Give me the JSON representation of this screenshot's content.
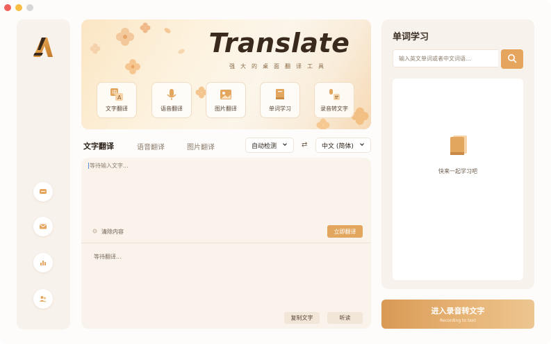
{
  "window": {
    "controls": [
      "close",
      "minimize",
      "maximize"
    ]
  },
  "sidebar": {
    "logo_letter": "A",
    "items": [
      {
        "icon": "chat-bubble-icon"
      },
      {
        "icon": "mail-icon"
      },
      {
        "icon": "chart-icon"
      },
      {
        "icon": "users-icon"
      }
    ]
  },
  "banner": {
    "title": "Translate",
    "subtitle": "强大的桌面翻译工具",
    "features": [
      {
        "label": "文字翻译",
        "icon": "text-translate-icon"
      },
      {
        "label": "语音翻译",
        "icon": "microphone-icon"
      },
      {
        "label": "图片翻译",
        "icon": "image-icon"
      },
      {
        "label": "单词学习",
        "icon": "book-icon"
      },
      {
        "label": "录音转文字",
        "icon": "recording-icon"
      }
    ]
  },
  "tabs": [
    {
      "label": "文字翻译",
      "active": true
    },
    {
      "label": "语音翻译",
      "active": false
    },
    {
      "label": "图片翻译",
      "active": false
    }
  ],
  "language": {
    "source": "自动检测",
    "swap_icon": "swap-icon",
    "target": "中文 (简体)"
  },
  "input": {
    "placeholder": "等待输入文字...",
    "clear_label": "清除内容",
    "translate_label": "立即翻译"
  },
  "output": {
    "placeholder": "等待翻译...",
    "copy_label": "复制文字",
    "listen_label": "听读"
  },
  "word_panel": {
    "title": "单词学习",
    "search_placeholder": "输入英文单词或者中文词语...",
    "empty_text": "快来一起学习吧"
  },
  "record_button": {
    "label": "进入录音转文字",
    "sublabel": "Recording to text"
  },
  "colors": {
    "accent": "#e2a65e",
    "panel_bg": "#f8f2ec",
    "text_dark": "#3b2f24"
  }
}
